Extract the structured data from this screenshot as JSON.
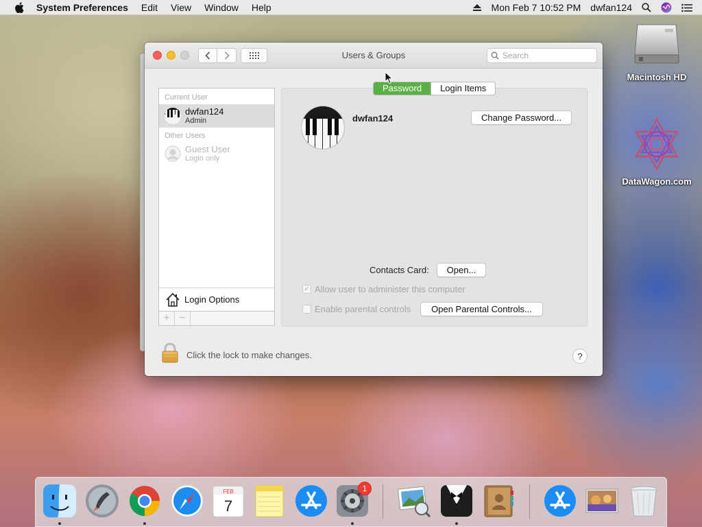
{
  "menubar": {
    "app_name": "System Preferences",
    "items": [
      "Edit",
      "View",
      "Window",
      "Help"
    ],
    "datetime": "Mon Feb 7  10:52 PM",
    "user": "dwfan124",
    "icons": [
      "apple-icon",
      "eject-icon",
      "spotlight-icon",
      "siri-icon",
      "notification-center-icon"
    ]
  },
  "desktop": {
    "icons": [
      {
        "label": "Macintosh HD",
        "icon": "hard-drive-icon"
      },
      {
        "label": "DataWagon.com",
        "icon": "datawagon-icon"
      }
    ]
  },
  "window": {
    "title": "Users & Groups",
    "search_placeholder": "Search",
    "sidebar": {
      "current_user_header": "Current User",
      "current_user": {
        "name": "dwfan124",
        "role": "Admin"
      },
      "other_users_header": "Other Users",
      "other_users": [
        {
          "name": "Guest User",
          "role": "Login only"
        }
      ],
      "login_options": "Login Options",
      "add_label": "+",
      "remove_label": "−"
    },
    "tabs": [
      {
        "label": "Password",
        "active": true
      },
      {
        "label": "Login Items",
        "active": false
      }
    ],
    "account": {
      "username": "dwfan124",
      "change_password": "Change Password...",
      "contacts_card_label": "Contacts Card:",
      "open_button": "Open...",
      "allow_admin": {
        "label": "Allow user to administer this computer",
        "checked": true,
        "enabled": false
      },
      "parental_controls": {
        "label": "Enable parental controls",
        "checked": false,
        "enabled": false
      },
      "open_parental_controls": "Open Parental Controls..."
    },
    "lock_text": "Click the lock to make changes.",
    "help_label": "?"
  },
  "dock": {
    "apps": [
      {
        "name": "Finder",
        "icon": "finder-icon",
        "running": true
      },
      {
        "name": "Launchpad",
        "icon": "launchpad-icon",
        "running": false
      },
      {
        "name": "Chrome",
        "icon": "chrome-icon",
        "running": true
      },
      {
        "name": "Safari",
        "icon": "safari-icon",
        "running": false
      },
      {
        "name": "Calendar",
        "icon": "calendar-icon",
        "running": false,
        "month": "FEB",
        "day": "7"
      },
      {
        "name": "Notes",
        "icon": "notes-icon",
        "running": false
      },
      {
        "name": "App Store",
        "icon": "app-store-icon",
        "running": false
      },
      {
        "name": "System Preferences",
        "icon": "system-preferences-icon",
        "running": true,
        "badge": "1"
      },
      {
        "name": "Preview",
        "icon": "preview-icon",
        "running": false
      },
      {
        "name": "Bartender",
        "icon": "bartender-icon",
        "running": true
      },
      {
        "name": "Contacts",
        "icon": "contacts-icon",
        "running": false
      },
      {
        "name": "App Store Downloads",
        "icon": "app-store-downloads-icon",
        "running": false
      },
      {
        "name": "Photo Stack",
        "icon": "photo-stack-icon",
        "running": false
      },
      {
        "name": "Trash",
        "icon": "trash-icon",
        "running": false
      }
    ]
  },
  "colors": {
    "accent_green": "#5bb045",
    "close": "#fc5f57",
    "minimize": "#fdbc2e",
    "badge": "#f23b33"
  }
}
